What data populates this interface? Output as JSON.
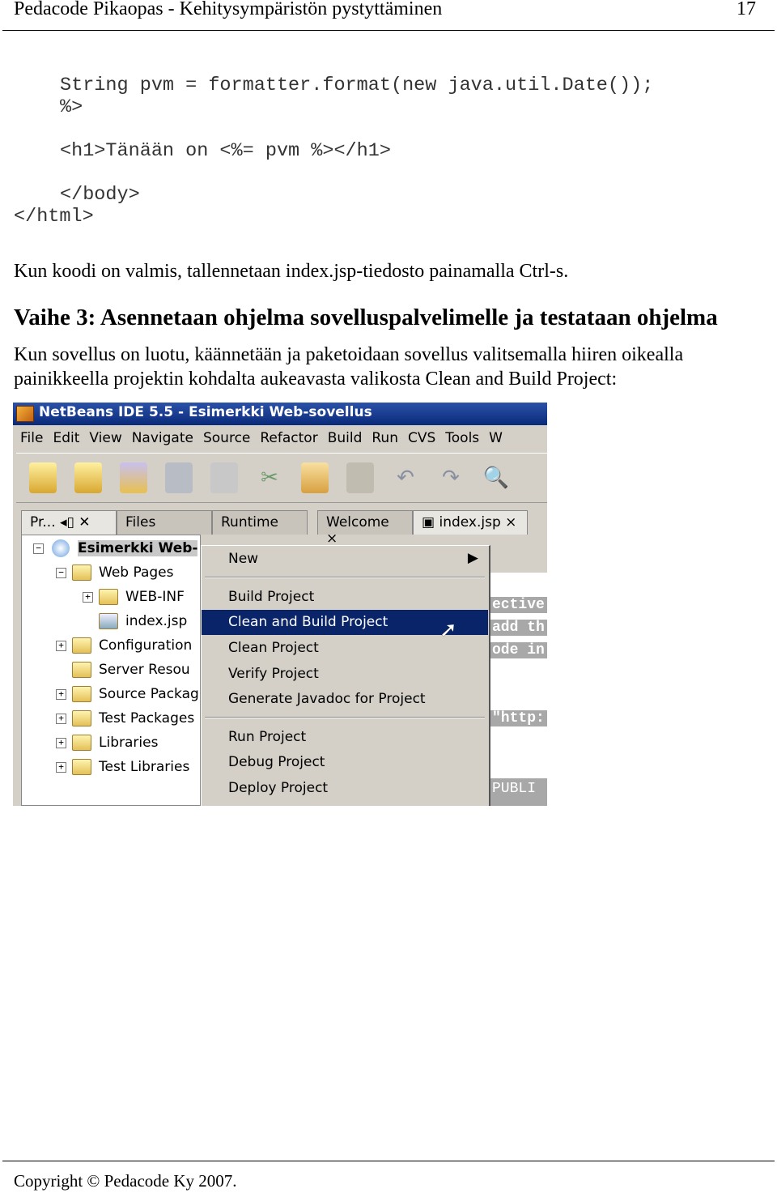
{
  "header": {
    "title": "Pedacode Pikaopas - Kehitysympäristön pystyttäminen",
    "page_number": "17"
  },
  "code_lines": [
    "String pvm = formatter.format(new java.util.Date());",
    "%>",
    "<h1>Tänään on <%= pvm %></h1>",
    "</body>",
    "</html>"
  ],
  "paragraph1": "Kun koodi on valmis, tallennetaan index.jsp-tiedosto painamalla Ctrl-s.",
  "heading": "Vaihe 3: Asennetaan ohjelma sovelluspalvelimelle ja testataan ohjelma",
  "paragraph2": [
    "Kun sovellus on luotu, käännetään ja paketoidaan sovellus valitsemalla hiiren oikealla",
    "painikkeella projektin kohdalta aukeavasta valikosta Clean and Build Project:"
  ],
  "screenshot": {
    "window_title": "NetBeans IDE 5.5 - Esimerkki Web-sovellus",
    "menu": [
      "File",
      "Edit",
      "View",
      "Navigate",
      "Source",
      "Refactor",
      "Build",
      "Run",
      "CVS",
      "Tools",
      "W"
    ],
    "toolbar_icons": [
      "new-file-icon",
      "new-project-icon",
      "open-project-icon",
      "save-icon",
      "find-icon",
      "cut-icon",
      "copy-icon",
      "paste-icon",
      "undo-icon",
      "redo-icon",
      "search-icon"
    ],
    "left_tabs": [
      "Pr...",
      "Files",
      "Runtime"
    ],
    "editor_tabs": [
      "Welcome",
      "index.jsp"
    ],
    "tree": {
      "root": "Esimerkki Web-",
      "items": [
        "Web Pages",
        "WEB-INF",
        "index.jsp",
        "Configuration",
        "Server Resou",
        "Source Packag",
        "Test Packages",
        "Libraries",
        "Test Libraries"
      ]
    },
    "context_menu": [
      "New",
      "Build Project",
      "Clean and Build Project",
      "Clean Project",
      "Verify Project",
      "Generate Javadoc for Project",
      "Run Project",
      "Debug Project",
      "Deploy Project"
    ],
    "selected_item": "Clean and Build Project",
    "editor_fragments": [
      "ective",
      "add th",
      "ode in",
      "\"http:",
      "PUBLI"
    ]
  },
  "footer": "Copyright © Pedacode Ky 2007."
}
